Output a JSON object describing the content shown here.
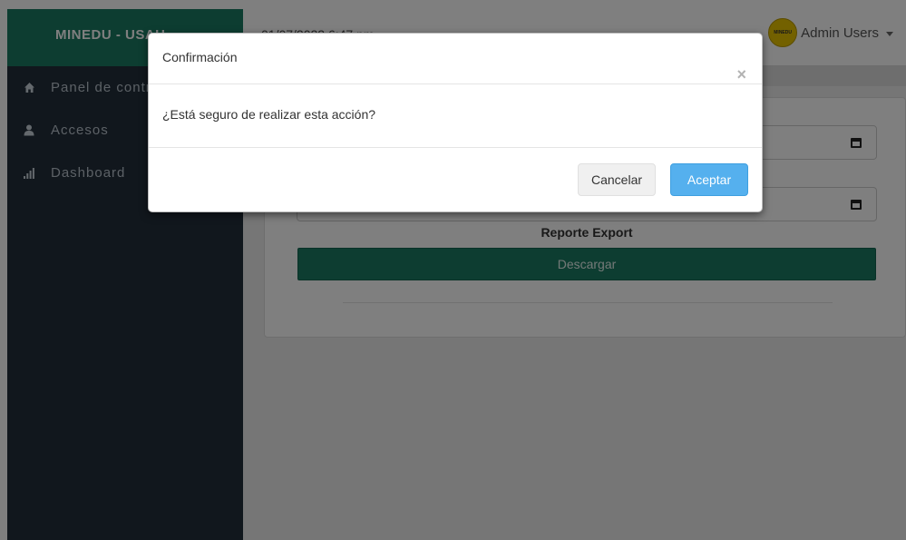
{
  "sidebar": {
    "brand": "MINEDU - USAH",
    "items": [
      {
        "label": "Panel de control",
        "icon": "home-icon"
      },
      {
        "label": "Accesos",
        "icon": "user-icon"
      },
      {
        "label": "Dashboard",
        "icon": "bar-chart-icon"
      }
    ]
  },
  "topbar": {
    "datetime": "01/07/2022 6:47 pm",
    "user_name": "Admin Users",
    "avatar_text": "MINEDU"
  },
  "main": {
    "report_title": "Reporte Export",
    "download_label": "Descargar"
  },
  "modal": {
    "title": "Confirmación",
    "close_symbol": "×",
    "message": "¿Está seguro de realizar esta acción?",
    "cancel_label": "Cancelar",
    "accept_label": "Aceptar"
  },
  "colors": {
    "brand_green": "#1b7a63",
    "sidebar_bg": "#232f3b",
    "accept_blue": "#55b0ee"
  }
}
